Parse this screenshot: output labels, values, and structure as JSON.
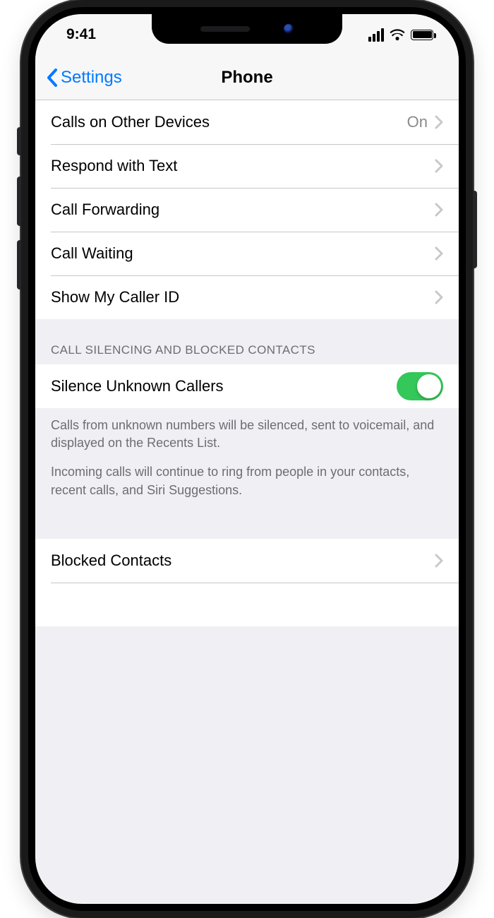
{
  "statusbar": {
    "time": "9:41"
  },
  "nav": {
    "back": "Settings",
    "title": "Phone"
  },
  "group1": {
    "rows": [
      {
        "label": "Calls on Other Devices",
        "value": "On"
      },
      {
        "label": "Respond with Text"
      },
      {
        "label": "Call Forwarding"
      },
      {
        "label": "Call Waiting"
      },
      {
        "label": "Show My Caller ID"
      }
    ]
  },
  "group2": {
    "header": "CALL SILENCING AND BLOCKED CONTACTS",
    "row": {
      "label": "Silence Unknown Callers",
      "toggle": true
    },
    "footer1": "Calls from unknown numbers will be silenced, sent to voicemail, and displayed on the Recents List.",
    "footer2": "Incoming calls will continue to ring from people in your contacts, recent calls, and Siri Suggestions."
  },
  "group3": {
    "rows": [
      {
        "label": "Blocked Contacts"
      }
    ]
  }
}
